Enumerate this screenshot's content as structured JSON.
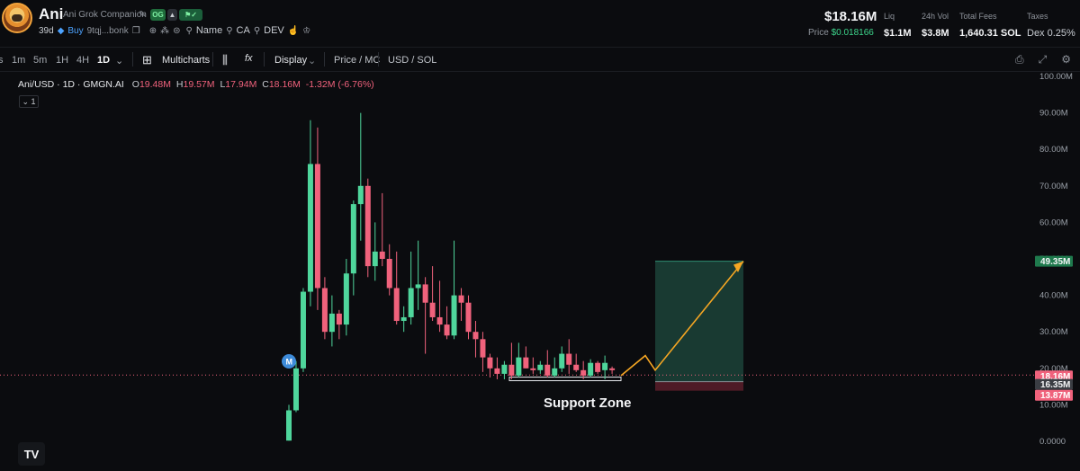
{
  "token": {
    "name": "Ani",
    "full_name": "Ani Grok Companion",
    "badge_og": "OG",
    "age": "39d",
    "buy_label": "Buy",
    "address": "9tqj...bonk",
    "links": [
      "Name",
      "CA",
      "DEV"
    ]
  },
  "stats": {
    "price_big": "$18.16M",
    "price_label": "Price",
    "price_value": "$0.018166",
    "liq_label": "Liq",
    "liq_value": "$1.1M",
    "vol_label": "24h Vol",
    "vol_value": "$3.8M",
    "fees_label": "Total Fees",
    "fees_value": "1,640.31 SOL",
    "taxes_label": "Taxes",
    "taxes_value": "Dex 0.25%"
  },
  "toolbar": {
    "timeframes": [
      "s",
      "1m",
      "5m",
      "1H",
      "4H",
      "1D"
    ],
    "active_timeframe": "1D",
    "multicharts": "Multicharts",
    "display": "Display",
    "price_mc": "Price / MC",
    "usd_sol": "USD / SOL"
  },
  "legend": {
    "pair": "Ani/USD · 1D · GMGN.AI",
    "o": "19.48M",
    "h": "19.57M",
    "l": "17.94M",
    "c": "18.16M",
    "change": "-1.32M (-6.76%)",
    "toggle": "1"
  },
  "colors": {
    "up": "#4fd69c",
    "down": "#f0627c",
    "accent_arrow": "#f5a623",
    "tp_zone": "#1f4a3f",
    "sl_zone": "#5a1f2a"
  },
  "chart_data": {
    "type": "candlestick",
    "ylim": [
      0,
      100000000
    ],
    "y_ticks": [
      "0.0000",
      "10.00M",
      "20.00M",
      "30.00M",
      "40.00M",
      "50.00M",
      "60.00M",
      "70.00M",
      "80.00M",
      "90.00M",
      "100.00M"
    ],
    "candles": [
      {
        "o": 0.2,
        "h": 10,
        "l": 0.2,
        "c": 8.5
      },
      {
        "o": 8.5,
        "h": 22,
        "l": 8,
        "c": 20
      },
      {
        "o": 20,
        "h": 42,
        "l": 19,
        "c": 41
      },
      {
        "o": 41,
        "h": 88,
        "l": 37,
        "c": 76
      },
      {
        "o": 76,
        "h": 86,
        "l": 36,
        "c": 42
      },
      {
        "o": 42,
        "h": 45,
        "l": 28,
        "c": 30
      },
      {
        "o": 30,
        "h": 40,
        "l": 26,
        "c": 35
      },
      {
        "o": 35,
        "h": 36,
        "l": 28,
        "c": 32
      },
      {
        "o": 32,
        "h": 50,
        "l": 29,
        "c": 46
      },
      {
        "o": 46,
        "h": 66,
        "l": 40,
        "c": 65
      },
      {
        "o": 65,
        "h": 90,
        "l": 55,
        "c": 70
      },
      {
        "o": 70,
        "h": 72,
        "l": 45,
        "c": 48
      },
      {
        "o": 48,
        "h": 60,
        "l": 44,
        "c": 52
      },
      {
        "o": 52,
        "h": 68,
        "l": 48,
        "c": 50
      },
      {
        "o": 50,
        "h": 54,
        "l": 40,
        "c": 42
      },
      {
        "o": 42,
        "h": 52,
        "l": 32,
        "c": 33
      },
      {
        "o": 33,
        "h": 37,
        "l": 30,
        "c": 34
      },
      {
        "o": 34,
        "h": 52,
        "l": 32,
        "c": 42
      },
      {
        "o": 42,
        "h": 55,
        "l": 36,
        "c": 43
      },
      {
        "o": 43,
        "h": 45,
        "l": 24,
        "c": 38
      },
      {
        "o": 38,
        "h": 48,
        "l": 33,
        "c": 34
      },
      {
        "o": 34,
        "h": 44,
        "l": 30,
        "c": 32
      },
      {
        "o": 32,
        "h": 37,
        "l": 28,
        "c": 29
      },
      {
        "o": 29,
        "h": 55,
        "l": 28,
        "c": 40
      },
      {
        "o": 40,
        "h": 42,
        "l": 33,
        "c": 38
      },
      {
        "o": 38,
        "h": 40,
        "l": 28,
        "c": 30
      },
      {
        "o": 30,
        "h": 33,
        "l": 23,
        "c": 28
      },
      {
        "o": 28,
        "h": 30,
        "l": 19,
        "c": 23
      },
      {
        "o": 23,
        "h": 24,
        "l": 17.5,
        "c": 20
      },
      {
        "o": 20,
        "h": 23,
        "l": 17,
        "c": 18.5
      },
      {
        "o": 18.5,
        "h": 22,
        "l": 17,
        "c": 21
      },
      {
        "o": 21,
        "h": 27,
        "l": 17,
        "c": 18
      },
      {
        "o": 18,
        "h": 27,
        "l": 17.5,
        "c": 23
      },
      {
        "o": 23,
        "h": 26,
        "l": 20,
        "c": 20
      },
      {
        "o": 20,
        "h": 23,
        "l": 18.5,
        "c": 19.5
      },
      {
        "o": 19.5,
        "h": 22,
        "l": 18.5,
        "c": 21
      },
      {
        "o": 21,
        "h": 25,
        "l": 17.5,
        "c": 18
      },
      {
        "o": 18,
        "h": 23,
        "l": 17.5,
        "c": 20
      },
      {
        "o": 20,
        "h": 26,
        "l": 19,
        "c": 24
      },
      {
        "o": 24,
        "h": 28,
        "l": 18.5,
        "c": 21
      },
      {
        "o": 21,
        "h": 24,
        "l": 19,
        "c": 19.5
      },
      {
        "o": 19.5,
        "h": 22,
        "l": 17,
        "c": 18
      },
      {
        "o": 18,
        "h": 22.5,
        "l": 17.5,
        "c": 21.5
      },
      {
        "o": 21.5,
        "h": 22,
        "l": 18.5,
        "c": 19
      },
      {
        "o": 19.5,
        "h": 23.5,
        "l": 17,
        "c": 21.5
      },
      {
        "o": 20,
        "h": 20.5,
        "l": 18.5,
        "c": 19.5
      }
    ],
    "annotations": {
      "support_label": "Support Zone",
      "marker_label": "M",
      "price_tags": [
        "49.35M",
        "18.16M",
        "16.35M",
        "13.87M"
      ],
      "current_price": 18.16,
      "target": 49.35,
      "entry": 16.35,
      "stop": 13.87
    }
  }
}
